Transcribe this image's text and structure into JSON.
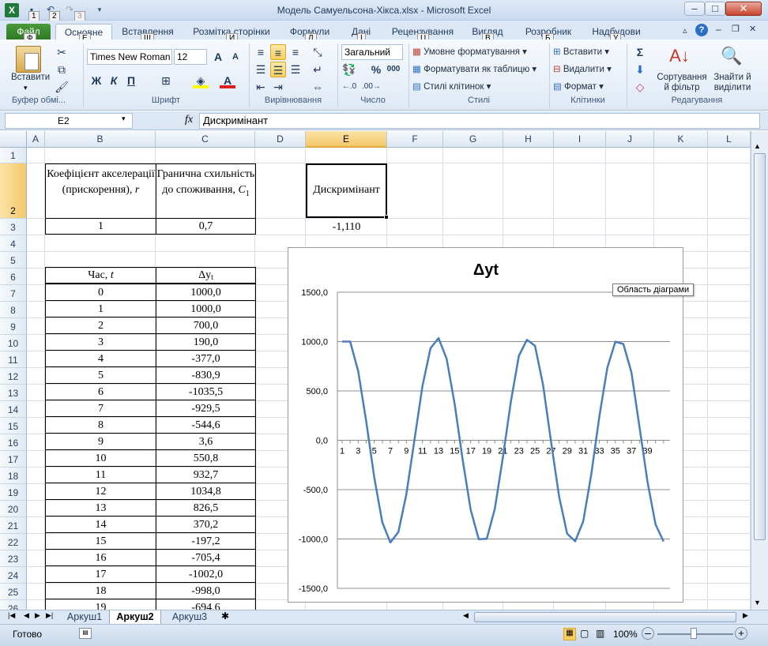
{
  "window": {
    "title": "Модель Самуельсона-Хікса.xlsx  -  Microsoft Excel",
    "app_icon": "excel-icon",
    "controls": {
      "minimize": "–",
      "maximize": "□",
      "close": "✕"
    },
    "qat_keytips": [
      "1",
      "2",
      "3"
    ]
  },
  "tabs": [
    {
      "label": "Файл",
      "keytip": "Ф"
    },
    {
      "label": "Основне",
      "keytip": "Е"
    },
    {
      "label": "Вставлення",
      "keytip": "Щ"
    },
    {
      "label": "Розмітка сторінки",
      "keytip": "И"
    },
    {
      "label": "Формули",
      "keytip": "Л"
    },
    {
      "label": "Дані",
      "keytip": "І"
    },
    {
      "label": "Рецензування",
      "keytip": "Ц"
    },
    {
      "label": "Вигляд",
      "keytip": "В"
    },
    {
      "label": "Розробник",
      "keytip": "Б"
    },
    {
      "label": "Надбудови",
      "keytip": "У"
    }
  ],
  "ribbon": {
    "clipboard": {
      "paste": "Вставити",
      "group": "Буфер обмі..."
    },
    "font": {
      "name": "Times New Roman",
      "size": "12",
      "group": "Шрифт",
      "bold": "Ж",
      "italic": "К",
      "underline": "П",
      "grow": "A",
      "shrink": "A"
    },
    "alignment": {
      "group": "Вирівнювання"
    },
    "number": {
      "format": "Загальний",
      "group": "Число",
      "percent": "%",
      "thousands": "000"
    },
    "styles": {
      "conditional": "Умовне форматування",
      "as_table": "Форматувати як таблицю",
      "cell_styles": "Стилі клітинок",
      "group": "Стилі"
    },
    "cells": {
      "insert": "Вставити",
      "delete": "Видалити",
      "format": "Формат",
      "group": "Клітинки"
    },
    "editing": {
      "sort": "Сортування й фільтр",
      "find": "Знайти й виділити",
      "group": "Редагування",
      "sum": "Σ"
    }
  },
  "formula_bar": {
    "name_box": "E2",
    "fx": "fx",
    "value": "Дискримінант"
  },
  "columns": [
    "A",
    "B",
    "C",
    "D",
    "E",
    "F",
    "G",
    "H",
    "I",
    "J",
    "K",
    "L"
  ],
  "rows": [
    "1",
    "2",
    "3",
    "4",
    "5",
    "6",
    "7",
    "8",
    "9",
    "10",
    "11",
    "12",
    "13",
    "14",
    "15",
    "16",
    "17",
    "18",
    "19",
    "20",
    "21",
    "22",
    "23",
    "24",
    "25",
    "26"
  ],
  "sheet": {
    "b2": "Коефіцієнт акселерації (прискорення),",
    "b2_var": "r",
    "c2": "Гранична схильність до споживання,",
    "c2_var": "C",
    "c2_sub": "1",
    "e2": "Дискримінант",
    "b3": "1",
    "c3": "0,7",
    "e3": "-1,110",
    "b6": "Час,",
    "b6_var": "t",
    "c6": "Δy",
    "c6_sub": "t",
    "time": [
      "0",
      "1",
      "2",
      "3",
      "4",
      "5",
      "6",
      "7",
      "8",
      "9",
      "10",
      "11",
      "12",
      "13",
      "14",
      "15",
      "16",
      "17",
      "18",
      "19"
    ],
    "dy": [
      "1000,0",
      "1000,0",
      "700,0",
      "190,0",
      "-377,0",
      "-830,9",
      "-1035,5",
      "-929,5",
      "-544,6",
      "3,6",
      "550,8",
      "932,7",
      "1034,8",
      "826,5",
      "370,2",
      "-197,2",
      "-705,4",
      "-1002,0",
      "-998,0",
      "-694,6"
    ]
  },
  "chart_data": {
    "type": "line",
    "title": "Δyt",
    "tooltip": "Область діаграми",
    "ylim": [
      -1500,
      1500
    ],
    "yticks": [
      "1500,0",
      "1000,0",
      "500,0",
      "0,0",
      "-500,0",
      "-1000,0",
      "-1500,0"
    ],
    "xticks": [
      "1",
      "3",
      "5",
      "7",
      "9",
      "11",
      "13",
      "15",
      "17",
      "19",
      "21",
      "23",
      "25",
      "27",
      "29",
      "31",
      "33",
      "35",
      "37",
      "39"
    ],
    "color": "#4a7ebb",
    "grid": true,
    "legend": "none",
    "series": [
      {
        "values": [
          1000,
          1000,
          700,
          190,
          -377,
          -830.9,
          -1035.5,
          -929.5,
          -544.6,
          3.6,
          550.8,
          932.7,
          1034.8,
          826.5,
          370.2,
          -197.2,
          -705.4,
          -1002,
          -998,
          -694.6,
          -176,
          392,
          857,
          1018,
          957,
          563,
          -15,
          -569,
          -946,
          -1023,
          -822,
          -347,
          236,
          734,
          999,
          975,
          688,
          137,
          -420,
          -852,
          -1025
        ]
      }
    ]
  },
  "sheet_tabs": [
    "Аркуш1",
    "Аркуш2",
    "Аркуш3"
  ],
  "status": {
    "ready": "Готово",
    "zoom": "100%"
  }
}
